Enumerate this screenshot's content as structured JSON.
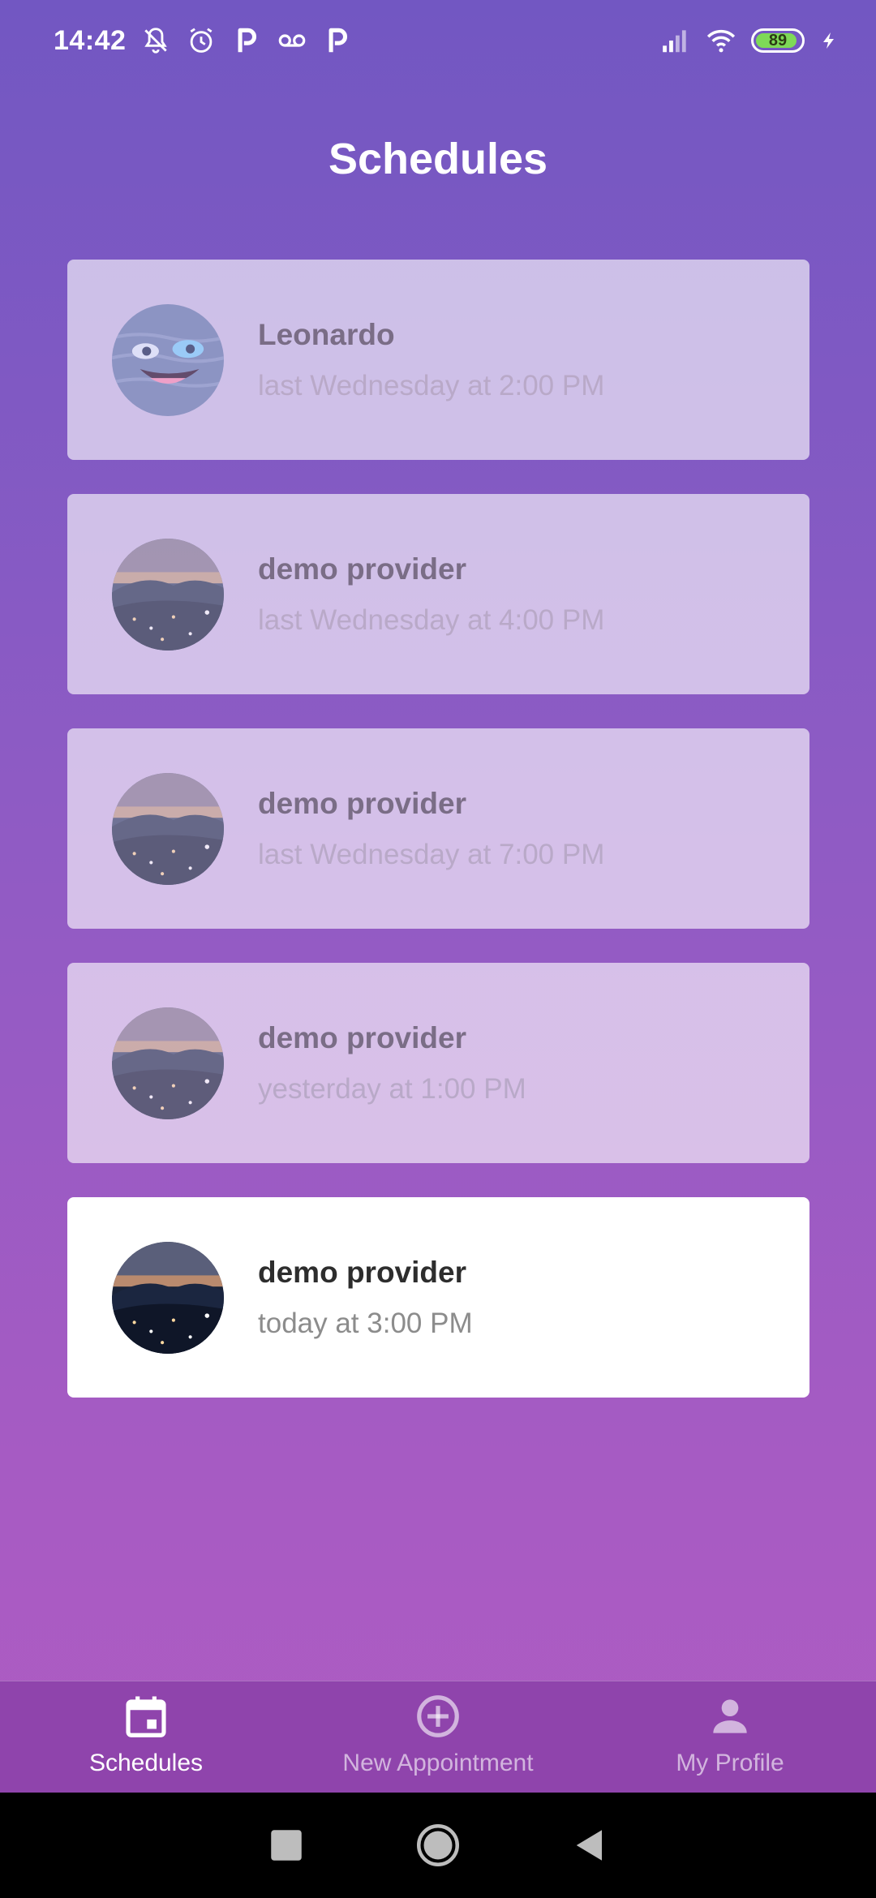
{
  "status_bar": {
    "time": "14:42",
    "battery": "89",
    "icons": [
      "notifications-off-icon",
      "alarm-icon",
      "p-app-icon",
      "voicemail-icon",
      "p-app-icon",
      "signal-icon",
      "wifi-icon",
      "battery-icon",
      "charging-icon"
    ]
  },
  "header": {
    "title": "Schedules"
  },
  "appointments": [
    {
      "name": "Leonardo",
      "time": "last Wednesday at 2:00 PM",
      "avatar": "cartoon-avatar",
      "state": "past"
    },
    {
      "name": "demo provider",
      "time": "last Wednesday at 4:00 PM",
      "avatar": "city-night-avatar",
      "state": "past"
    },
    {
      "name": "demo provider",
      "time": "last Wednesday at 7:00 PM",
      "avatar": "city-night-avatar",
      "state": "past"
    },
    {
      "name": "demo provider",
      "time": "yesterday at 1:00 PM",
      "avatar": "city-night-avatar",
      "state": "past"
    },
    {
      "name": "demo provider",
      "time": "today at 3:00 PM",
      "avatar": "city-night-avatar",
      "state": "current"
    }
  ],
  "bottom_nav": {
    "items": [
      {
        "label": "Schedules",
        "icon": "calendar-icon",
        "active": true
      },
      {
        "label": "New Appointment",
        "icon": "add-circle-icon",
        "active": false
      },
      {
        "label": "My Profile",
        "icon": "person-icon",
        "active": false
      }
    ]
  },
  "colors": {
    "gradient_top": "#7257c2",
    "gradient_bottom": "#b05cc2",
    "nav_background": "#8f44ac",
    "battery_green": "#7ed957"
  }
}
